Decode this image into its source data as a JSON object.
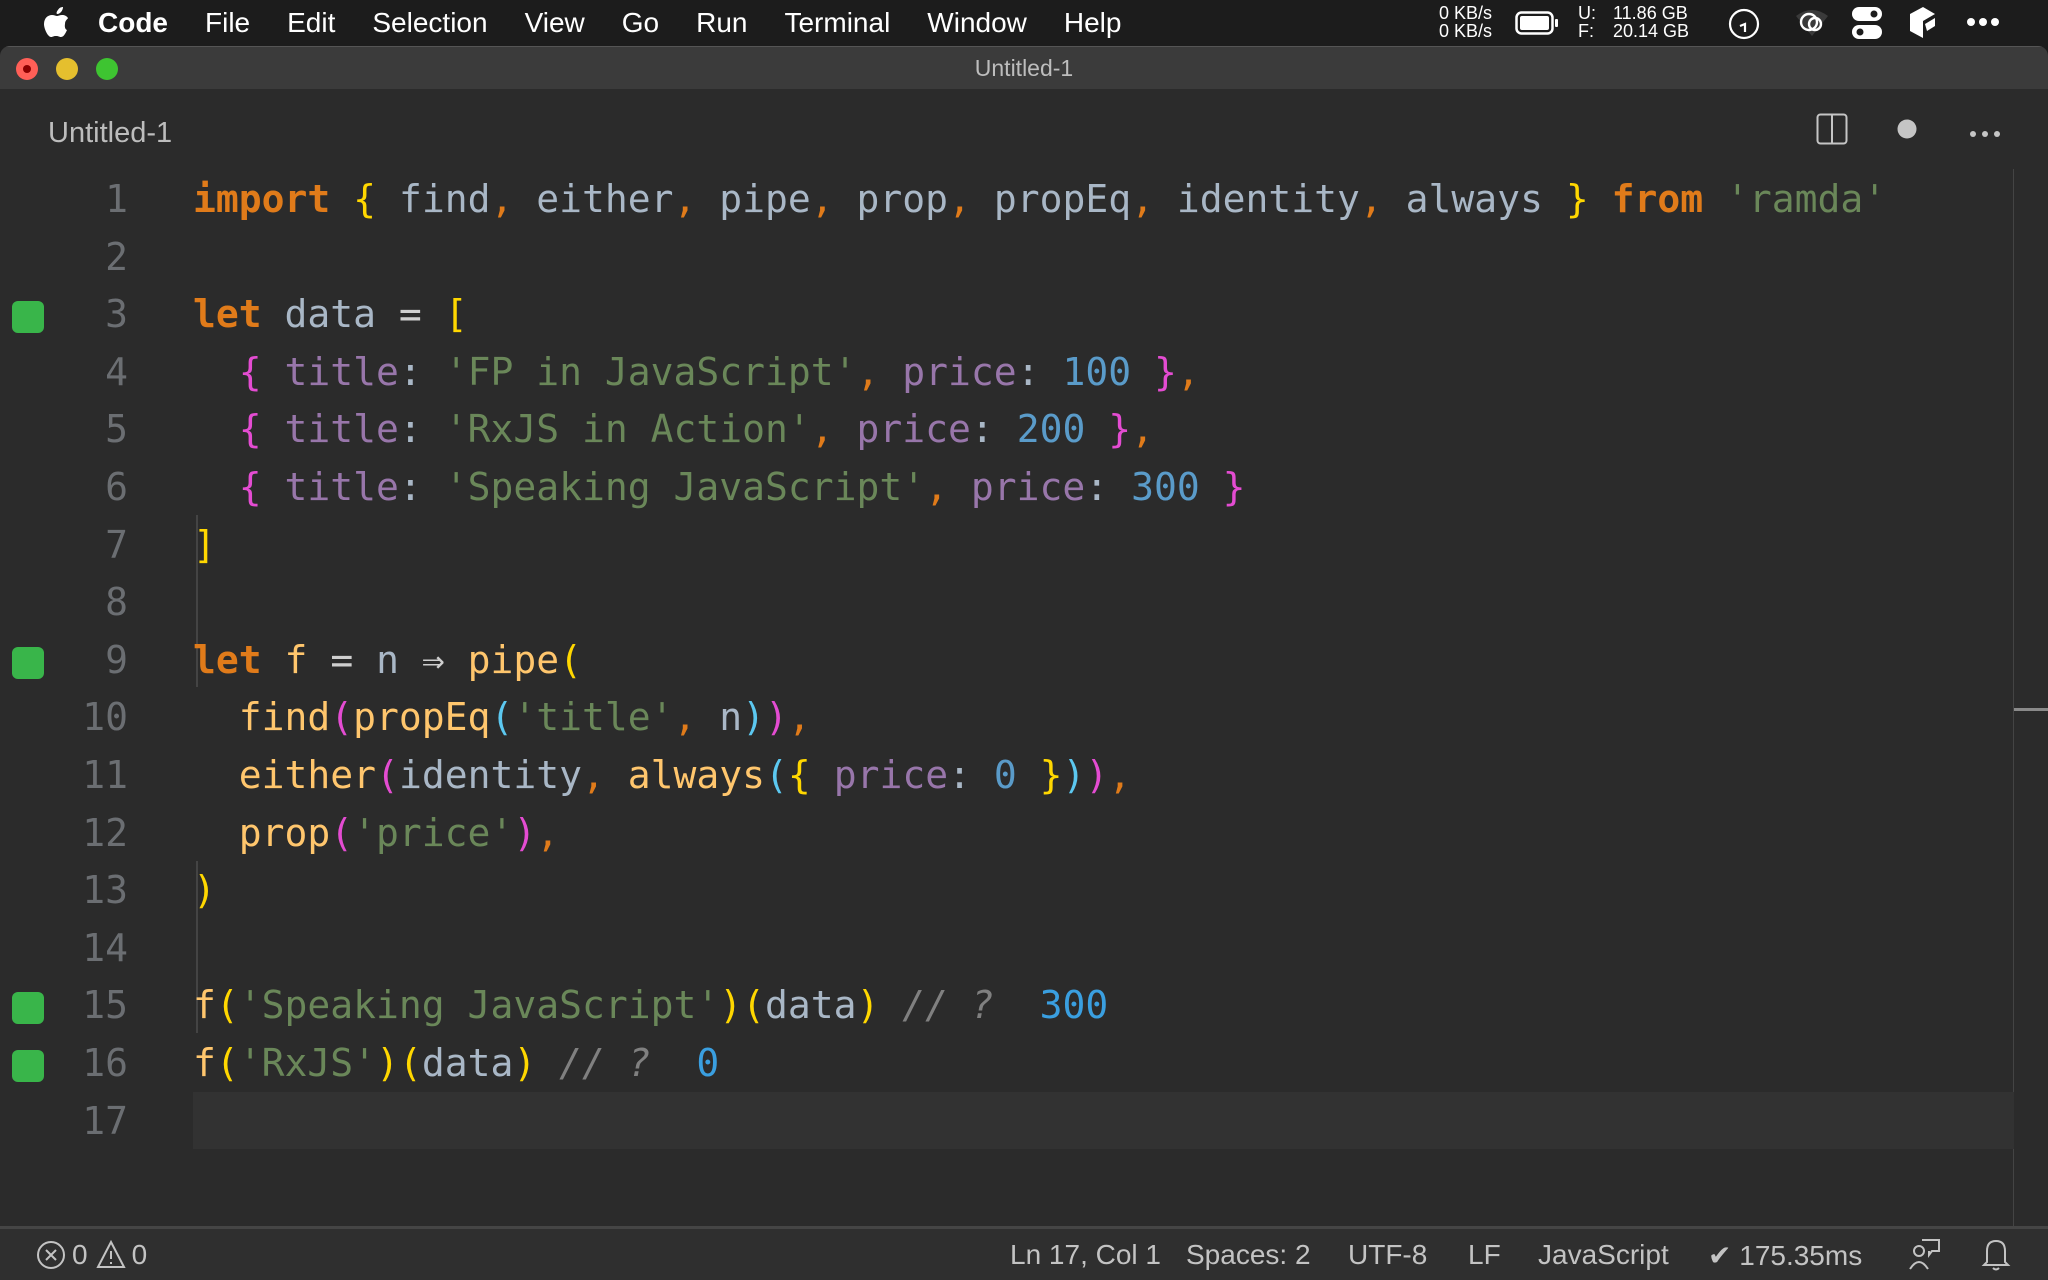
{
  "menubar": {
    "apple_icon": "apple-logo-icon",
    "app_name": "Code",
    "items": [
      "File",
      "Edit",
      "Selection",
      "View",
      "Go",
      "Run",
      "Terminal",
      "Window",
      "Help"
    ],
    "net_up": "0 KB/s",
    "net_down": "0 KB/s",
    "disk_used_label": "U:",
    "disk_used": "11.86 GB",
    "disk_free_label": "F:",
    "disk_free": "20.14 GB",
    "tray_icons": [
      "battery-icon",
      "clock-icon",
      "creative-cloud-icon",
      "control-center-icon",
      "app-icon",
      "more-icon"
    ]
  },
  "window": {
    "title": "Untitled-1"
  },
  "tab": {
    "label": "Untitled-1",
    "actions": [
      "split-editor-icon",
      "unsaved-dot-icon",
      "more-actions-icon"
    ]
  },
  "editor": {
    "lines": [
      {
        "num": "1",
        "mark": false,
        "tokens": [
          [
            "k",
            "import"
          ],
          [
            "v",
            " "
          ],
          [
            "b1",
            "{"
          ],
          [
            "v",
            " find"
          ],
          [
            "pun",
            ","
          ],
          [
            "v",
            " either"
          ],
          [
            "pun",
            ","
          ],
          [
            "v",
            " pipe"
          ],
          [
            "pun",
            ","
          ],
          [
            "v",
            " prop"
          ],
          [
            "pun",
            ","
          ],
          [
            "v",
            " propEq"
          ],
          [
            "pun",
            ","
          ],
          [
            "v",
            " identity"
          ],
          [
            "pun",
            ","
          ],
          [
            "v",
            " always "
          ],
          [
            "b1",
            "}"
          ],
          [
            "v",
            " "
          ],
          [
            "k",
            "from"
          ],
          [
            "v",
            " "
          ],
          [
            "s",
            "'ramda'"
          ]
        ]
      },
      {
        "num": "2",
        "mark": false,
        "tokens": []
      },
      {
        "num": "3",
        "mark": true,
        "tokens": [
          [
            "k",
            "let"
          ],
          [
            "v",
            " data "
          ],
          [
            "op",
            "="
          ],
          [
            "v",
            " "
          ],
          [
            "b1",
            "["
          ]
        ]
      },
      {
        "num": "4",
        "mark": false,
        "tokens": [
          [
            "v",
            "  "
          ],
          [
            "b2",
            "{"
          ],
          [
            "v",
            " "
          ],
          [
            "p",
            "title"
          ],
          [
            "v",
            ": "
          ],
          [
            "s",
            "'FP in JavaScript'"
          ],
          [
            "pun",
            ","
          ],
          [
            "v",
            " "
          ],
          [
            "p",
            "price"
          ],
          [
            "v",
            ": "
          ],
          [
            "n",
            "100"
          ],
          [
            "v",
            " "
          ],
          [
            "b2",
            "}"
          ],
          [
            "pun",
            ","
          ]
        ]
      },
      {
        "num": "5",
        "mark": false,
        "tokens": [
          [
            "v",
            "  "
          ],
          [
            "b2",
            "{"
          ],
          [
            "v",
            " "
          ],
          [
            "p",
            "title"
          ],
          [
            "v",
            ": "
          ],
          [
            "s",
            "'RxJS in Action'"
          ],
          [
            "pun",
            ","
          ],
          [
            "v",
            " "
          ],
          [
            "p",
            "price"
          ],
          [
            "v",
            ": "
          ],
          [
            "n",
            "200"
          ],
          [
            "v",
            " "
          ],
          [
            "b2",
            "}"
          ],
          [
            "pun",
            ","
          ]
        ]
      },
      {
        "num": "6",
        "mark": false,
        "tokens": [
          [
            "v",
            "  "
          ],
          [
            "b2",
            "{"
          ],
          [
            "v",
            " "
          ],
          [
            "p",
            "title"
          ],
          [
            "v",
            ": "
          ],
          [
            "s",
            "'Speaking JavaScript'"
          ],
          [
            "pun",
            ","
          ],
          [
            "v",
            " "
          ],
          [
            "p",
            "price"
          ],
          [
            "v",
            ": "
          ],
          [
            "n",
            "300"
          ],
          [
            "v",
            " "
          ],
          [
            "b2",
            "}"
          ]
        ]
      },
      {
        "num": "7",
        "mark": false,
        "tokens": [
          [
            "b1",
            "]"
          ]
        ]
      },
      {
        "num": "8",
        "mark": false,
        "tokens": []
      },
      {
        "num": "9",
        "mark": true,
        "tokens": [
          [
            "k",
            "let"
          ],
          [
            "v",
            " "
          ],
          [
            "fn",
            "f"
          ],
          [
            "v",
            " "
          ],
          [
            "op",
            "="
          ],
          [
            "v",
            " n "
          ],
          [
            "op",
            "⇒"
          ],
          [
            "v",
            " "
          ],
          [
            "fn",
            "pipe"
          ],
          [
            "b1",
            "("
          ]
        ]
      },
      {
        "num": "10",
        "mark": false,
        "tokens": [
          [
            "v",
            "  "
          ],
          [
            "fn",
            "find"
          ],
          [
            "b2",
            "("
          ],
          [
            "fn",
            "propEq"
          ],
          [
            "b3",
            "("
          ],
          [
            "s",
            "'title'"
          ],
          [
            "pun",
            ","
          ],
          [
            "v",
            " n"
          ],
          [
            "b3",
            ")"
          ],
          [
            "b2",
            ")"
          ],
          [
            "pun",
            ","
          ]
        ]
      },
      {
        "num": "11",
        "mark": false,
        "tokens": [
          [
            "v",
            "  "
          ],
          [
            "fn",
            "either"
          ],
          [
            "b2",
            "("
          ],
          [
            "v",
            "identity"
          ],
          [
            "pun",
            ","
          ],
          [
            "v",
            " "
          ],
          [
            "fn",
            "always"
          ],
          [
            "b3",
            "("
          ],
          [
            "b1",
            "{"
          ],
          [
            "v",
            " "
          ],
          [
            "p",
            "price"
          ],
          [
            "v",
            ": "
          ],
          [
            "n",
            "0"
          ],
          [
            "v",
            " "
          ],
          [
            "b1",
            "}"
          ],
          [
            "b3",
            ")"
          ],
          [
            "b2",
            ")"
          ],
          [
            "pun",
            ","
          ]
        ]
      },
      {
        "num": "12",
        "mark": false,
        "tokens": [
          [
            "v",
            "  "
          ],
          [
            "fn",
            "prop"
          ],
          [
            "b2",
            "("
          ],
          [
            "s",
            "'price'"
          ],
          [
            "b2",
            ")"
          ],
          [
            "pun",
            ","
          ]
        ]
      },
      {
        "num": "13",
        "mark": false,
        "tokens": [
          [
            "b1",
            ")"
          ]
        ]
      },
      {
        "num": "14",
        "mark": false,
        "tokens": []
      },
      {
        "num": "15",
        "mark": true,
        "tokens": [
          [
            "fn",
            "f"
          ],
          [
            "b1",
            "("
          ],
          [
            "s",
            "'Speaking JavaScript'"
          ],
          [
            "b1",
            ")"
          ],
          [
            "b1",
            "("
          ],
          [
            "v",
            "data"
          ],
          [
            "b1",
            ")"
          ],
          [
            "v",
            " "
          ],
          [
            "cm",
            "// ?"
          ],
          [
            "v",
            "  "
          ],
          [
            "res",
            "300"
          ]
        ]
      },
      {
        "num": "16",
        "mark": true,
        "tokens": [
          [
            "fn",
            "f"
          ],
          [
            "b1",
            "("
          ],
          [
            "s",
            "'RxJS'"
          ],
          [
            "b1",
            ")"
          ],
          [
            "b1",
            "("
          ],
          [
            "v",
            "data"
          ],
          [
            "b1",
            ")"
          ],
          [
            "v",
            " "
          ],
          [
            "cm",
            "// ?"
          ],
          [
            "v",
            "  "
          ],
          [
            "res",
            "0"
          ]
        ]
      },
      {
        "num": "17",
        "mark": false,
        "current": true,
        "tokens": []
      }
    ]
  },
  "statusbar": {
    "errors": "0",
    "warnings": "0",
    "cursor": "Ln 17, Col 1",
    "indent": "Spaces: 2",
    "encoding": "UTF-8",
    "eol": "LF",
    "language": "JavaScript",
    "timing": "✔ 175.35ms",
    "icons": [
      "feedback-icon",
      "notifications-bell-icon"
    ]
  },
  "colors": {
    "run_marker": "#39b54a",
    "keyword": "#e07b1a",
    "string": "#6a8759",
    "property": "#9876aa",
    "number": "#5a9bc9",
    "function": "#ffc66d",
    "result": "#3a9fe0"
  }
}
